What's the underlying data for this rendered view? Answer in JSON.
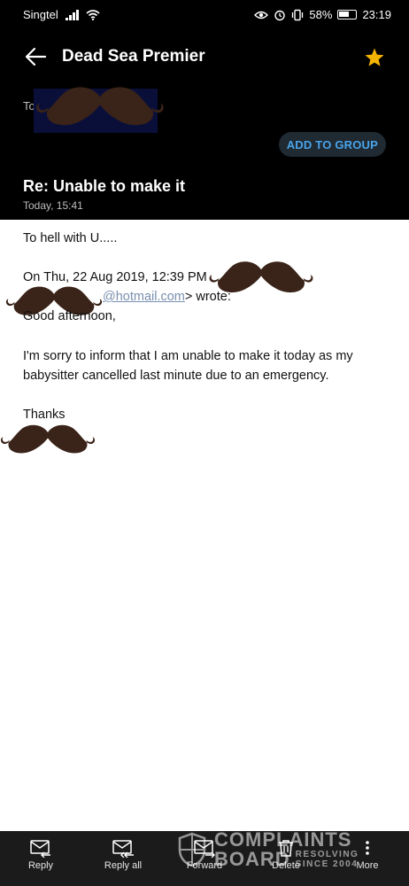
{
  "status_bar": {
    "carrier": "Singtel",
    "battery_percent": "58%",
    "time": "23:19"
  },
  "header": {
    "title": "Dead Sea Premier",
    "to_label": "To",
    "add_to_group_label": "ADD TO GROUP",
    "subject": "Re: Unable to make it",
    "date": "Today, 15:41"
  },
  "message": {
    "reply_line": "To hell with U.....",
    "quote_header": "On Thu, 22 Aug 2019, 12:39 PM",
    "quote_email_partial": "@hotmail.com",
    "quote_wrote": "> wrote:",
    "greeting": "Good afternoon,",
    "paragraph_line1": "I'm sorry to inform that I am unable to make it today as my",
    "paragraph_line2": "babysitter cancelled last minute due to an emergency.",
    "closing": "Thanks"
  },
  "bottom_bar": {
    "reply": "Reply",
    "reply_all": "Reply all",
    "forward": "Forward",
    "delete": "Delete",
    "more": "More"
  },
  "watermark": {
    "line1": "COMPLAINTS",
    "line2": "BOARD",
    "tag1": "RESOLVING",
    "tag2": "SINCE 2004"
  },
  "icons": {
    "back": "arrow-left-icon",
    "star": "star-icon",
    "reply": "reply-icon",
    "reply_all": "reply-all-icon",
    "forward": "forward-icon",
    "delete": "trash-icon",
    "more": "more-vertical-icon"
  },
  "colors": {
    "header_bg": "#000000",
    "star": "#f5b301",
    "accent_link": "#4aa3e8",
    "mustache": "#3a2318"
  }
}
